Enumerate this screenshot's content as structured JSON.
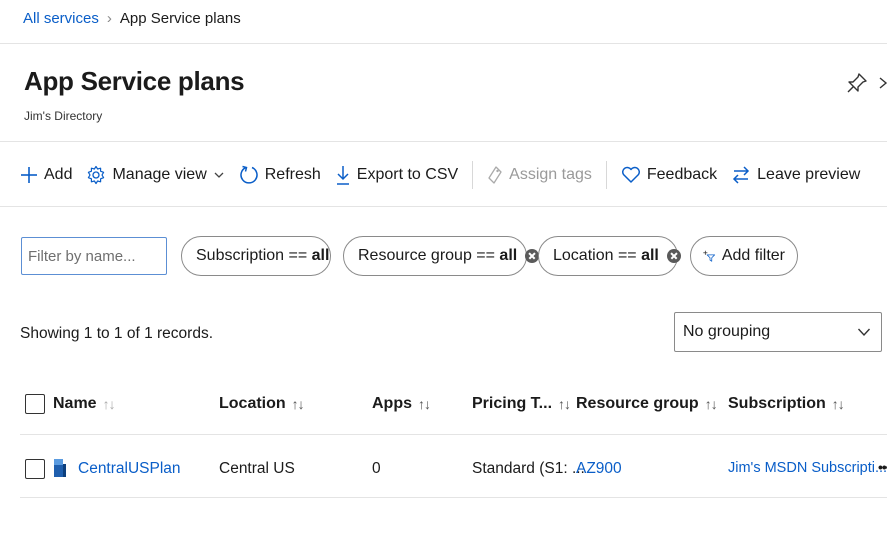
{
  "breadcrumb": {
    "root": "All services",
    "current": "App Service plans"
  },
  "header": {
    "title": "App Service plans",
    "subtitle": "Jim's Directory"
  },
  "toolbar": {
    "add": "Add",
    "manage_view": "Manage view",
    "refresh": "Refresh",
    "export": "Export to CSV",
    "assign_tags": "Assign tags",
    "feedback": "Feedback",
    "leave_preview": "Leave preview"
  },
  "filters": {
    "search_placeholder": "Filter by name...",
    "subscription": {
      "label": "Subscription == ",
      "value": "all"
    },
    "resource_group": {
      "label": "Resource group == ",
      "value": "all"
    },
    "location": {
      "label": "Location == ",
      "value": "all"
    },
    "add_filter": "Add filter"
  },
  "records_text": "Showing 1 to 1 of 1 records.",
  "grouping": {
    "selected": "No grouping"
  },
  "table": {
    "columns": [
      "Name",
      "Location",
      "Apps",
      "Pricing T...",
      "Resource group",
      "Subscription"
    ],
    "rows": [
      {
        "name": "CentralUSPlan",
        "location": "Central US",
        "apps": "0",
        "pricing": "Standard (S1: ...",
        "resource_group": "AZ900",
        "subscription": "Jim's MSDN Subscripti...",
        "more": "•••"
      }
    ]
  },
  "colors": {
    "link": "#0a5ec8",
    "filter_focus": "#5c8fd4",
    "border": "#8a8a8a"
  },
  "icons": [
    "chevron-right-icon",
    "pin-icon",
    "plus-icon",
    "gear-icon",
    "chevron-down-icon",
    "refresh-icon",
    "download-icon",
    "tag-icon",
    "heart-icon",
    "swap-icon",
    "close-circle-icon",
    "add-filter-icon",
    "app-service-plan-icon"
  ]
}
